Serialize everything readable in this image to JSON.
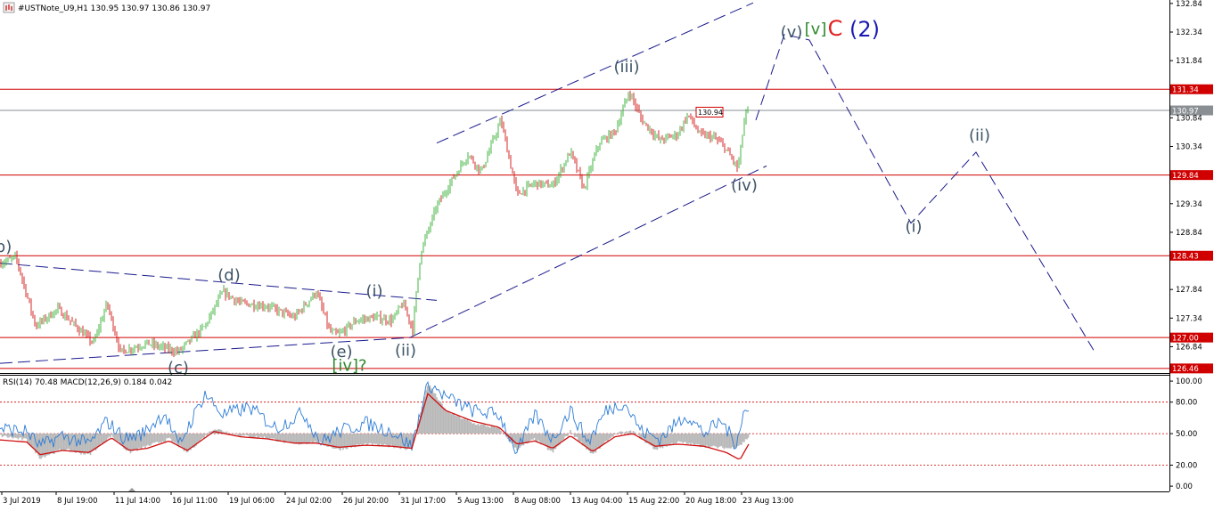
{
  "window": {
    "symbol_header": "#USTNote_U9,H1  130.95 130.97 130.86 130.97",
    "indicator_header": "RSI(14) 70.48 MACD(12,26,9) 0.184 0.042"
  },
  "colors": {
    "bull": "#2fae2f",
    "bear": "#d01010",
    "hline": "#d00000",
    "trend": "#1a1a8c",
    "wave_grey": "#3d5466",
    "wave_green": "#2f8a2f",
    "wave_red": "#e02020",
    "wave_blue": "#1a1ab4",
    "rsi": "#2d7cd6",
    "macd_hist": "#b8b8b8",
    "signal": "#d01010"
  },
  "chart_data": [
    {
      "type": "candlestick",
      "name": "",
      "ylim": [
        126.38,
        132.9
      ],
      "y_ticks": [
        "132.84",
        "132.34",
        "131.84",
        "130.84",
        "130.34",
        "129.34",
        "128.84",
        "127.84",
        "127.34",
        "126.84"
      ],
      "x_ticks": [
        "3 Jul 2019",
        "8 Jul 19:00",
        "11 Jul 14:00",
        "16 Jul 11:00",
        "19 Jul 06:00",
        "24 Jul 02:00",
        "26 Jul 20:00",
        "31 Jul 17:00",
        "5 Aug 13:00",
        "8 Aug 08:00",
        "13 Aug 04:00",
        "15 Aug 22:00",
        "20 Aug 18:00",
        "23 Aug 13:00"
      ],
      "last_price": "130.97",
      "price_path": [
        [
          0,
          128.3
        ],
        [
          18,
          128.4
        ],
        [
          40,
          127.2
        ],
        [
          65,
          127.5
        ],
        [
          105,
          126.9
        ],
        [
          120,
          127.6
        ],
        [
          135,
          126.75
        ],
        [
          165,
          126.9
        ],
        [
          200,
          126.75
        ],
        [
          230,
          127.2
        ],
        [
          250,
          127.8
        ],
        [
          270,
          127.6
        ],
        [
          300,
          127.55
        ],
        [
          330,
          127.35
        ],
        [
          355,
          127.8
        ],
        [
          370,
          127.1
        ],
        [
          380,
          127.05
        ],
        [
          400,
          127.3
        ],
        [
          420,
          127.35
        ],
        [
          440,
          127.3
        ],
        [
          452,
          127.6
        ],
        [
          463,
          127.15
        ],
        [
          472,
          128.5
        ],
        [
          490,
          129.3
        ],
        [
          505,
          129.7
        ],
        [
          525,
          130.2
        ],
        [
          540,
          129.9
        ],
        [
          562,
          130.8
        ],
        [
          580,
          129.5
        ],
        [
          600,
          129.7
        ],
        [
          620,
          129.65
        ],
        [
          640,
          130.25
        ],
        [
          655,
          129.6
        ],
        [
          672,
          130.4
        ],
        [
          690,
          130.6
        ],
        [
          706,
          131.3
        ],
        [
          720,
          130.8
        ],
        [
          740,
          130.45
        ],
        [
          760,
          130.55
        ],
        [
          772,
          130.9
        ],
        [
          785,
          130.55
        ],
        [
          800,
          130.5
        ],
        [
          812,
          130.35
        ],
        [
          828,
          129.95
        ],
        [
          836,
          130.9
        ],
        [
          840,
          130.97
        ]
      ],
      "horizontal_levels": [
        {
          "value": 131.34,
          "label": "131.34"
        },
        {
          "value": 130.97,
          "label": "130.97",
          "style": "current"
        },
        {
          "value": 129.84,
          "label": "129.84"
        },
        {
          "value": 128.43,
          "label": "128.43"
        },
        {
          "value": 127.0,
          "label": "127.00"
        },
        {
          "value": 126.46,
          "label": "126.46"
        }
      ],
      "price_tag": {
        "label": "130.94",
        "at": [
          795,
          130.94
        ]
      },
      "trend_lines": [
        {
          "from": [
            0,
            128.3
          ],
          "to": [
            490,
            127.65
          ]
        },
        {
          "from": [
            0,
            126.55
          ],
          "to": [
            460,
            127.0
          ]
        },
        {
          "from": [
            460,
            127.0
          ],
          "to": [
            860,
            130.0
          ]
        },
        {
          "from": [
            490,
            130.4
          ],
          "to": [
            845,
            132.85
          ]
        }
      ],
      "projection_path": [
        [
          848,
          130.8
        ],
        [
          880,
          132.3
        ],
        [
          908,
          132.2
        ],
        [
          1022,
          129.0
        ],
        [
          1095,
          130.24
        ],
        [
          1228,
          126.75
        ]
      ],
      "wave_labels": [
        {
          "text": "b)",
          "at": [
            4,
            128.5
          ],
          "color": "wave_grey"
        },
        {
          "text": "(d)",
          "at": [
            257,
            128.0
          ],
          "color": "wave_grey"
        },
        {
          "text": "(c)",
          "at": [
            200,
            126.38
          ],
          "color": "wave_grey"
        },
        {
          "text": "(e)",
          "at": [
            383,
            126.66
          ],
          "color": "wave_grey"
        },
        {
          "text": "[iv]?",
          "at": [
            392,
            126.42
          ],
          "color": "wave_green"
        },
        {
          "text": "(i)",
          "at": [
            420,
            127.72
          ],
          "color": "wave_grey"
        },
        {
          "text": "(ii)",
          "at": [
            455,
            126.68
          ],
          "color": "wave_grey"
        },
        {
          "text": "(iii)",
          "at": [
            703,
            131.64
          ],
          "color": "wave_grey"
        },
        {
          "text": "(iv)",
          "at": [
            835,
            129.57
          ],
          "color": "wave_grey"
        },
        {
          "text": "(v)",
          "at": [
            888,
            132.25
          ],
          "color": "wave_grey"
        },
        {
          "text": "[v]",
          "at": [
            915,
            132.3
          ],
          "color": "wave_green"
        },
        {
          "text": "C",
          "at": [
            937,
            132.28
          ],
          "color": "wave_red"
        },
        {
          "text": "(2)",
          "at": [
            970,
            132.26
          ],
          "color": "wave_blue"
        },
        {
          "text": "(i)",
          "at": [
            1025,
            128.85
          ],
          "color": "wave_grey"
        },
        {
          "text": "(ii)",
          "at": [
            1099,
            130.44
          ],
          "color": "wave_grey"
        }
      ]
    },
    {
      "type": "line",
      "name": "RSI(14) 70.48 MACD(12,26,9) 0.184 0.042",
      "ylim": [
        -5,
        106
      ],
      "y_ticks": [
        "100.00",
        "80.00",
        "50.00",
        "20.00",
        "0.00"
      ],
      "levels": [
        80,
        50,
        20
      ],
      "rsi_path": [
        [
          0,
          55
        ],
        [
          30,
          52
        ],
        [
          45,
          38
        ],
        [
          70,
          48
        ],
        [
          100,
          40
        ],
        [
          120,
          62
        ],
        [
          140,
          45
        ],
        [
          160,
          50
        ],
        [
          185,
          70
        ],
        [
          200,
          38
        ],
        [
          230,
          88
        ],
        [
          250,
          68
        ],
        [
          280,
          75
        ],
        [
          310,
          55
        ],
        [
          340,
          70
        ],
        [
          360,
          42
        ],
        [
          380,
          52
        ],
        [
          410,
          60
        ],
        [
          440,
          52
        ],
        [
          462,
          38
        ],
        [
          480,
          98
        ],
        [
          500,
          85
        ],
        [
          530,
          72
        ],
        [
          560,
          68
        ],
        [
          580,
          32
        ],
        [
          600,
          68
        ],
        [
          620,
          45
        ],
        [
          640,
          72
        ],
        [
          660,
          42
        ],
        [
          680,
          72
        ],
        [
          700,
          80
        ],
        [
          720,
          52
        ],
        [
          740,
          45
        ],
        [
          770,
          68
        ],
        [
          790,
          50
        ],
        [
          810,
          62
        ],
        [
          825,
          40
        ],
        [
          835,
          72
        ],
        [
          840,
          70
        ]
      ],
      "macd_path": [
        [
          0,
          48
        ],
        [
          30,
          44
        ],
        [
          45,
          27
        ],
        [
          70,
          35
        ],
        [
          100,
          30
        ],
        [
          125,
          48
        ],
        [
          145,
          32
        ],
        [
          165,
          38
        ],
        [
          190,
          45
        ],
        [
          210,
          32
        ],
        [
          240,
          55
        ],
        [
          270,
          48
        ],
        [
          300,
          46
        ],
        [
          330,
          40
        ],
        [
          355,
          42
        ],
        [
          380,
          35
        ],
        [
          410,
          40
        ],
        [
          440,
          38
        ],
        [
          462,
          35
        ],
        [
          480,
          98
        ],
        [
          500,
          72
        ],
        [
          530,
          60
        ],
        [
          560,
          55
        ],
        [
          580,
          35
        ],
        [
          600,
          45
        ],
        [
          620,
          32
        ],
        [
          640,
          52
        ],
        [
          665,
          30
        ],
        [
          690,
          50
        ],
        [
          710,
          52
        ],
        [
          735,
          35
        ],
        [
          760,
          42
        ],
        [
          790,
          38
        ],
        [
          820,
          36
        ],
        [
          832,
          40
        ],
        [
          840,
          47
        ]
      ],
      "signal_path": [
        [
          0,
          44
        ],
        [
          30,
          42
        ],
        [
          45,
          30
        ],
        [
          70,
          34
        ],
        [
          100,
          32
        ],
        [
          125,
          46
        ],
        [
          145,
          34
        ],
        [
          165,
          36
        ],
        [
          190,
          43
        ],
        [
          210,
          34
        ],
        [
          240,
          52
        ],
        [
          270,
          47
        ],
        [
          300,
          45
        ],
        [
          330,
          41
        ],
        [
          355,
          41
        ],
        [
          380,
          37
        ],
        [
          410,
          39
        ],
        [
          440,
          38
        ],
        [
          462,
          36
        ],
        [
          480,
          88
        ],
        [
          500,
          72
        ],
        [
          530,
          62
        ],
        [
          560,
          56
        ],
        [
          580,
          40
        ],
        [
          600,
          43
        ],
        [
          620,
          36
        ],
        [
          640,
          48
        ],
        [
          665,
          33
        ],
        [
          690,
          47
        ],
        [
          710,
          50
        ],
        [
          735,
          38
        ],
        [
          760,
          40
        ],
        [
          790,
          38
        ],
        [
          815,
          32
        ],
        [
          830,
          25
        ],
        [
          840,
          40
        ]
      ]
    }
  ]
}
